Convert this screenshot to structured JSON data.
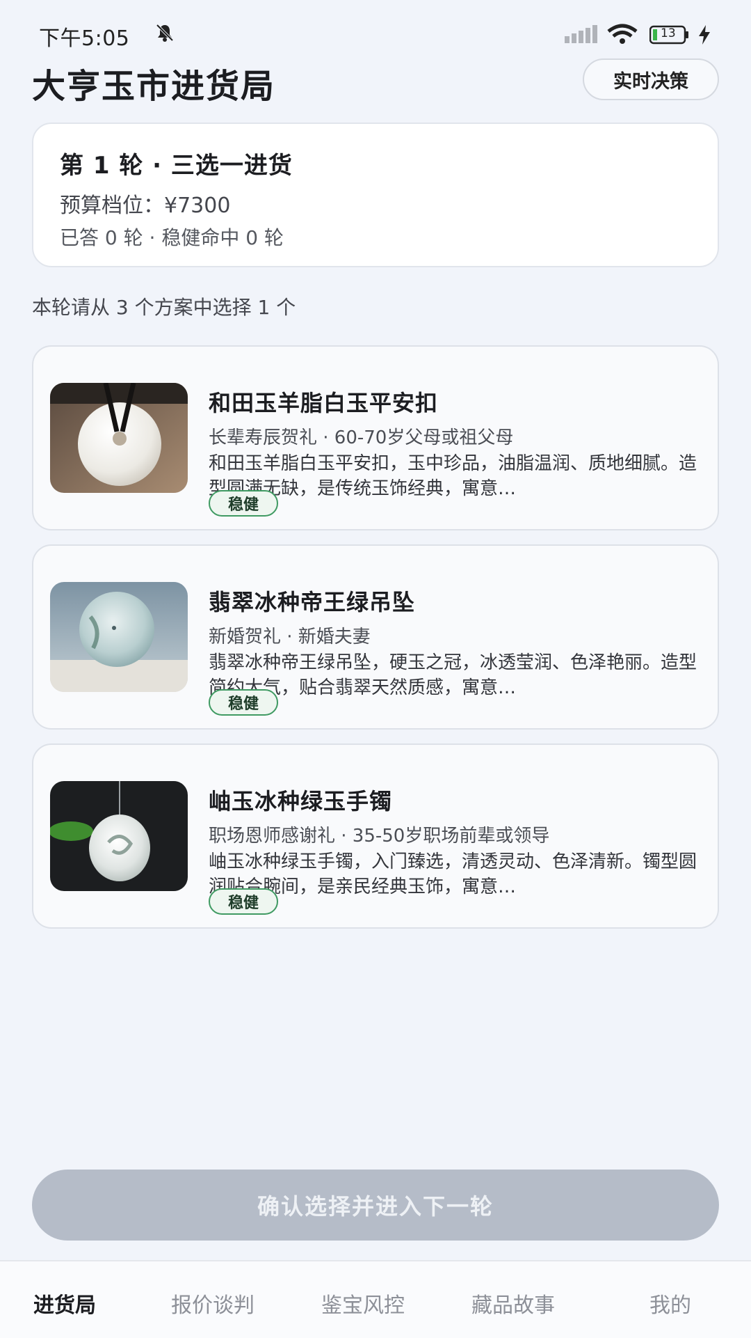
{
  "status_bar": {
    "time": "下午5:05",
    "battery": "13"
  },
  "header": {
    "title": "大亨玉市进货局",
    "realtime_button": "实时决策"
  },
  "round": {
    "title": "第 1 轮 · 三选一进货",
    "budget": "预算档位：¥7300",
    "stats": "已答 0 轮 · 稳健命中 0 轮"
  },
  "hint": "本轮请从 3 个方案中选择 1 个",
  "options": [
    {
      "name": "和田玉羊脂白玉平安扣",
      "meta": "长辈寿辰贺礼 · 60-70岁父母或祖父母",
      "desc": "和田玉羊脂白玉平安扣，玉中珍品，油脂温润、质地细腻。造型圆满无缺，是传统玉饰经典，寓意…",
      "badge": "稳健",
      "thumb_icon": "white-jade-pendant-image"
    },
    {
      "name": "翡翠冰种帝王绿吊坠",
      "meta": "新婚贺礼 · 新婚夫妻",
      "desc": "翡翠冰种帝王绿吊坠，硬玉之冠，冰透莹润、色泽艳丽。造型简约大气，贴合翡翠天然质感，寓意…",
      "badge": "稳健",
      "thumb_icon": "jadeite-pendant-image"
    },
    {
      "name": "岫玉冰种绿玉手镯",
      "meta": "职场恩师感谢礼 · 35-50岁职场前辈或领导",
      "desc": "岫玉冰种绿玉手镯，入门臻选，清透灵动、色泽清新。镯型圆润贴合腕间，是亲民经典玉饰，寓意…",
      "badge": "稳健",
      "thumb_icon": "jade-carving-image"
    }
  ],
  "confirm_button": "确认选择并进入下一轮",
  "nav": [
    "进货局",
    "报价谈判",
    "鉴宝风控",
    "藏品故事",
    "我的"
  ],
  "colors": {
    "badge_green": "#3f9a62",
    "confirm_disabled": "#b5bcc8"
  }
}
